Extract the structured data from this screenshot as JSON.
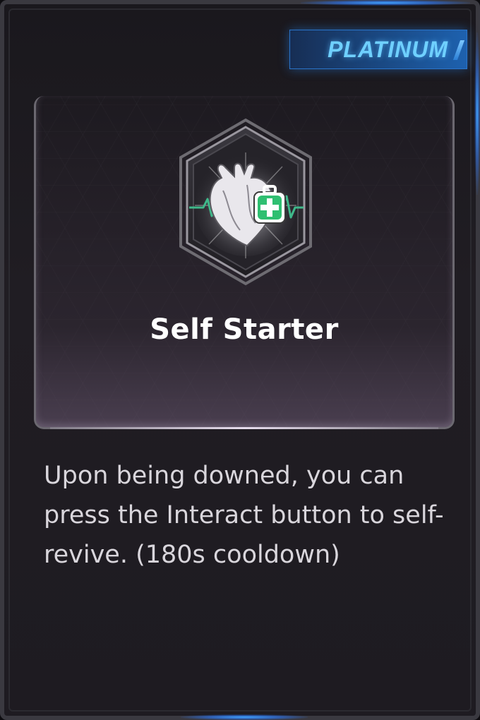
{
  "card": {
    "rarity": "PLATINUM",
    "perk_name": "Self Starter",
    "description": "Upon being downed, you can press the Interact button to self-revive. (180s cooldown)",
    "icon": "heart-with-medkit-icon",
    "colors": {
      "rarity_accent": "#6fd0ff",
      "glow": "#3fa2ff",
      "medkit_green": "#2fbf71",
      "ecg_line": "#3fb88a"
    }
  }
}
